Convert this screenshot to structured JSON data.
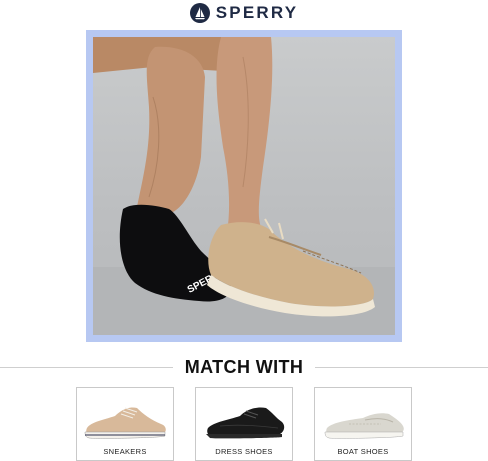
{
  "brand": {
    "name": "SPERRY",
    "logo_icon": "sailboat-icon",
    "colors": {
      "primary": "#1f2a44",
      "frame": "#b7c8f2"
    }
  },
  "section": {
    "title": "MATCH WITH"
  },
  "products": [
    {
      "label": "SNEAKERS",
      "icon": "sneaker-icon"
    },
    {
      "label": "DRESS SHOES",
      "icon": "dress-shoe-icon"
    },
    {
      "label": "BOAT SHOES",
      "icon": "boat-shoe-icon"
    }
  ],
  "sock_print": "SPERRY"
}
